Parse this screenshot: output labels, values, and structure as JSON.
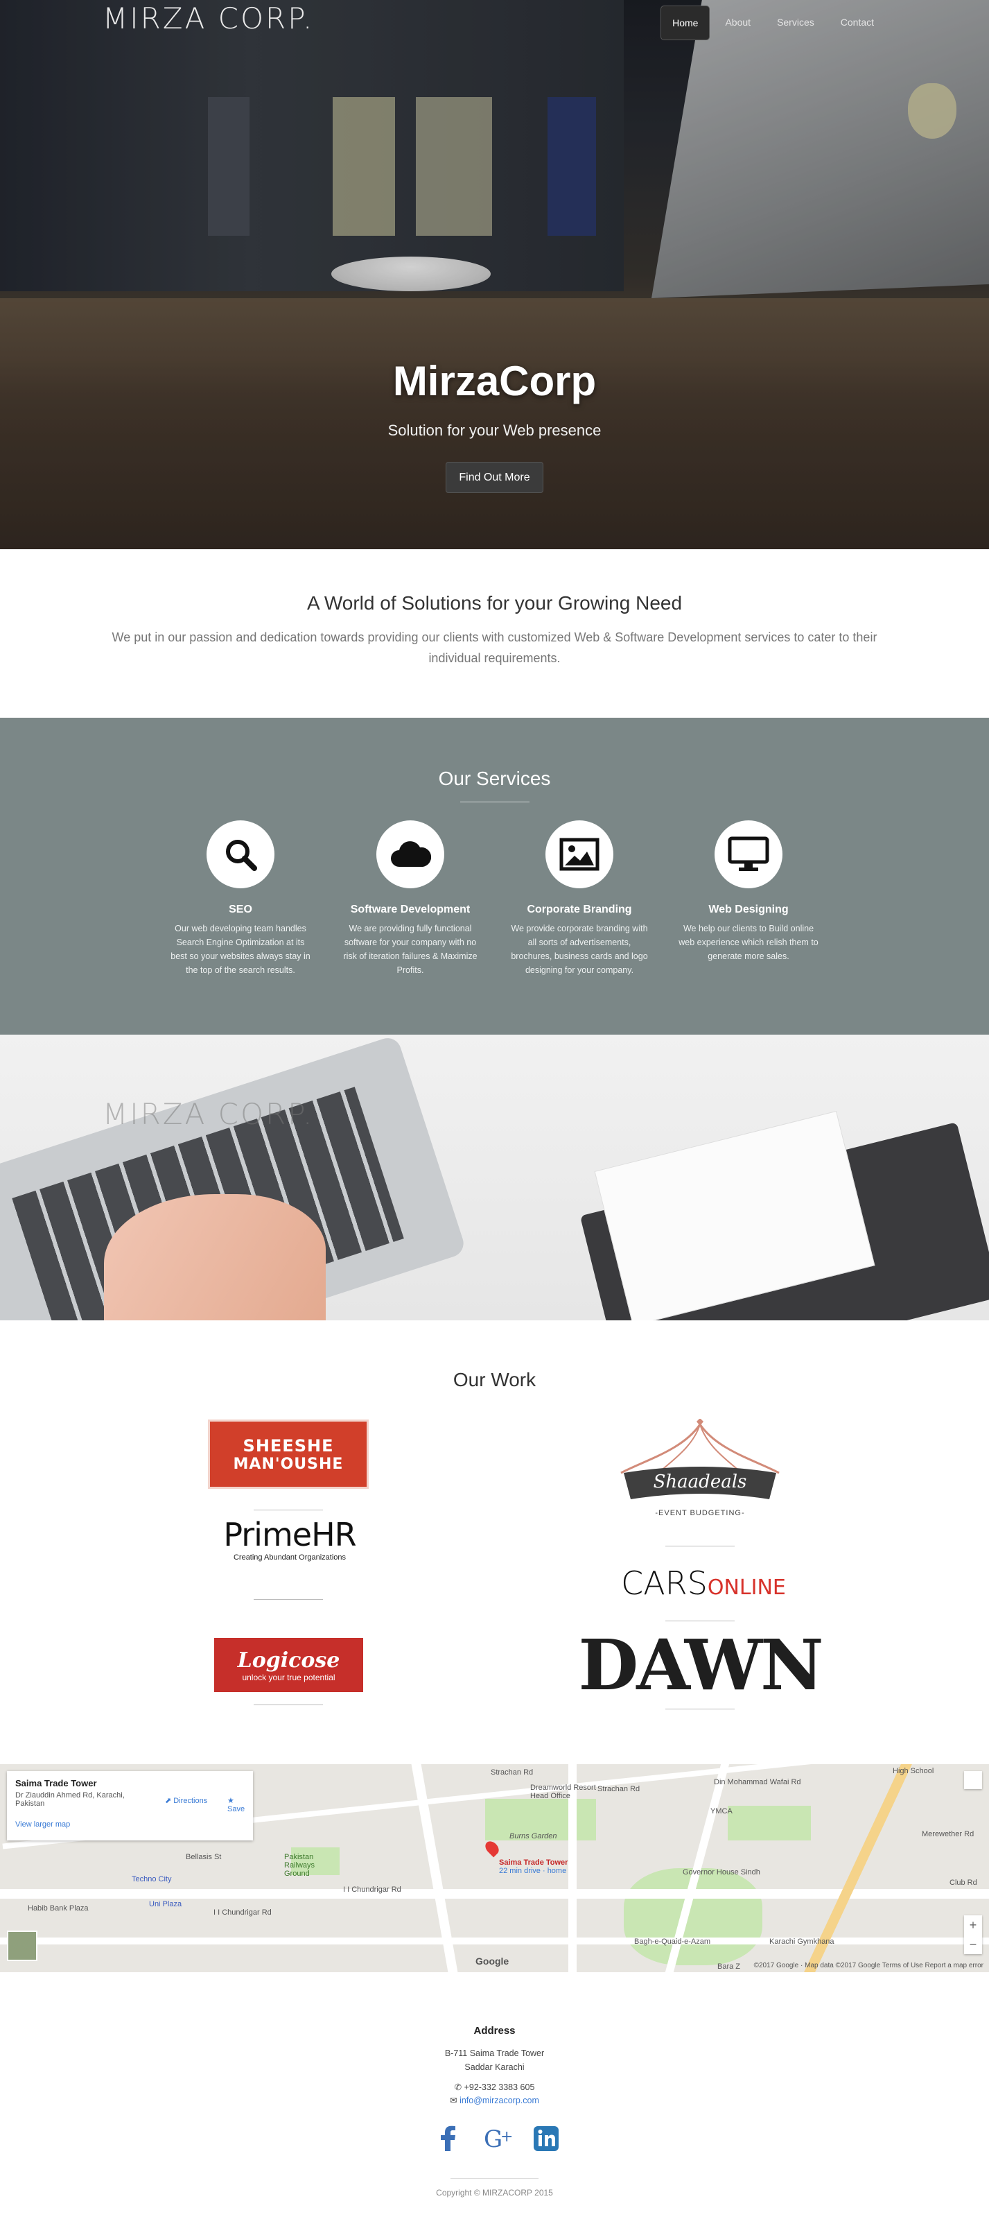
{
  "brand": {
    "logo": "MIRZA CORP."
  },
  "nav": {
    "items": [
      {
        "label": "Home",
        "active": true
      },
      {
        "label": "About",
        "active": false
      },
      {
        "label": "Services",
        "active": false
      },
      {
        "label": "Contact",
        "active": false
      }
    ]
  },
  "hero": {
    "title": "MirzaCorp",
    "subtitle": "Solution for your Web presence",
    "cta": "Find Out More"
  },
  "intro": {
    "title": "A World of Solutions for your Growing Need",
    "text": "We put in our passion and dedication towards providing our clients with customized Web & Software Development services to cater to their individual requirements."
  },
  "services": {
    "title": "Our Services",
    "items": [
      {
        "icon": "search-icon",
        "title": "SEO",
        "text": "Our web developing team handles Search Engine Optimization at its best so your websites always stay in the top of the search results."
      },
      {
        "icon": "cloud-icon",
        "title": "Software Development",
        "text": "We are providing fully functional software for your company with no risk of iteration failures & Maximize Profits."
      },
      {
        "icon": "image-icon",
        "title": "Corporate Branding",
        "text": "We provide corporate branding with all sorts of advertisements, brochures, business cards and logo designing for your company."
      },
      {
        "icon": "desktop-icon",
        "title": "Web Designing",
        "text": "We help our clients to Build online web experience which relish them to generate more sales."
      }
    ]
  },
  "work": {
    "title": "Our Work",
    "clients": {
      "sheeshe": {
        "line1": "SHEESHE",
        "line2": "MAN'OUSHE"
      },
      "primehr": {
        "name": "PrimeHR",
        "tagline": "Creating Abundant Organizations"
      },
      "logicose": {
        "name": "Logicose",
        "tagline": "unlock your true potential"
      },
      "shaadeals": {
        "name": "Shaadeals",
        "tagline": "-EVENT BUDGETING-"
      },
      "carsonline": {
        "part1": "CARS",
        "part2": "ONLINE"
      },
      "dawn": {
        "name": "DAWN"
      }
    }
  },
  "map": {
    "place": "Saima Trade Tower",
    "address": "Dr Ziauddin Ahmed Rd, Karachi, Pakistan",
    "directions": "Directions",
    "save": "Save",
    "larger": "View larger map",
    "pin_label": "Saima Trade Tower",
    "pin_sub": "22 min drive · home",
    "labels": [
      "Strachan Rd",
      "Dreamworld Resort Head Office",
      "Strachan Rd",
      "Din Mohammad Wafai Rd",
      "YMCA",
      "High School",
      "Burns Garden",
      "Bellasis St",
      "Pakistan Railways Ground",
      "Techno City",
      "Uni Plaza",
      "Habib Bank Plaza",
      "I I Chundrigar Rd",
      "I I Chundrigar Rd",
      "Governor House Sindh",
      "Bagh-e-Quaid-e-Azam",
      "Karachi Gymkhana",
      "Club Rd",
      "Merewether Rd",
      "Bara Z"
    ],
    "footer": "©2017 Google · Map data ©2017 Google   Terms of Use   Report a map error",
    "google": "Google"
  },
  "footer": {
    "heading": "Address",
    "line1": "B-711 Saima Trade Tower",
    "line2": "Saddar Karachi",
    "phone": "+92-332 3383 605",
    "email": "info@mirzacorp.com",
    "copyright": "Copyright © MIRZACORP 2015"
  },
  "colors": {
    "services_bg": "#7b8787",
    "link": "#3a7bd5",
    "facebook": "#3b6fb6",
    "linkedin": "#2a78b5"
  }
}
